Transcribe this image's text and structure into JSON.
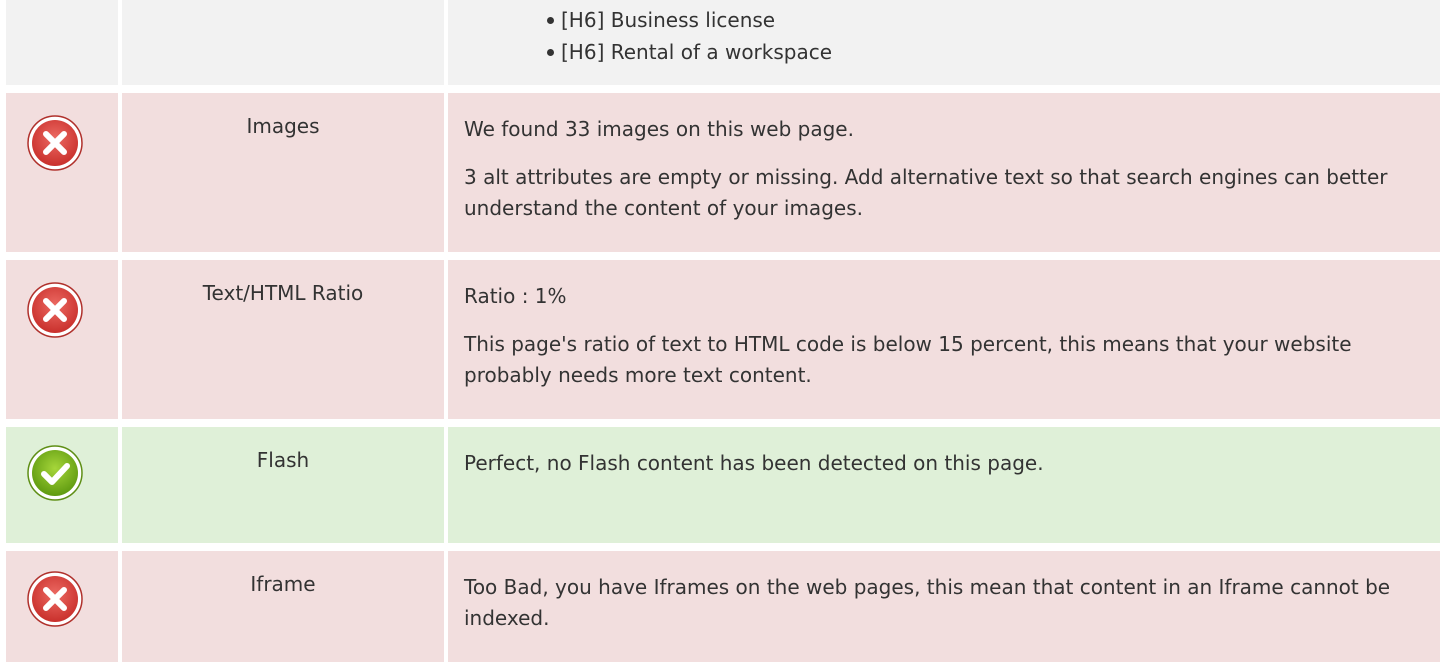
{
  "headings_row": {
    "items": [
      "[H6] Business license",
      "[H6] Rental of a workspace"
    ]
  },
  "rows": [
    {
      "status": "error",
      "label": "Images",
      "line1": "We found 33 images on this web page.",
      "line2": "3 alt attributes are empty or missing. Add alternative text so that search engines can better understand the content of your images."
    },
    {
      "status": "error",
      "label": "Text/HTML Ratio",
      "line1": "Ratio : 1%",
      "line2": "This page's ratio of text to HTML code is below 15 percent, this means that your website probably needs more text content."
    },
    {
      "status": "success",
      "label": "Flash",
      "line1": "Perfect, no Flash content has been detected on this page."
    },
    {
      "status": "error",
      "label": "Iframe",
      "line1": "Too Bad, you have Iframes on the web pages, this mean that content in an Iframe cannot be indexed."
    }
  ],
  "colors": {
    "error_bg": "#f2dede",
    "success_bg": "#dff0d8",
    "neutral_bg": "#f2f2f2",
    "error_icon": "#d9534f",
    "success_icon": "#7cb518"
  },
  "icons": {
    "error": "error-x-icon",
    "success": "success-check-icon"
  }
}
